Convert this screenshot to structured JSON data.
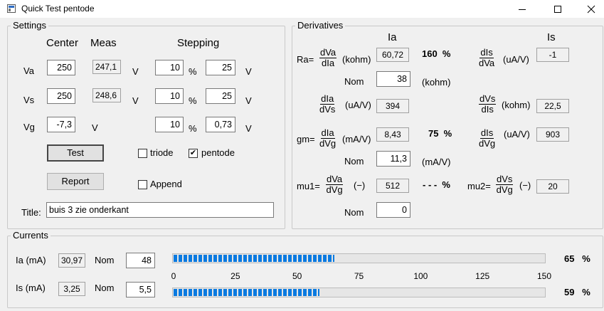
{
  "window": {
    "title": "Quick Test pentode"
  },
  "settings": {
    "group_label": "Settings",
    "col_center": "Center",
    "col_meas": "Meas",
    "col_stepping": "Stepping",
    "rows": [
      {
        "label": "Va",
        "center": "250",
        "meas": "247,1",
        "unit1": "V",
        "step_pct": "10",
        "pct_sign": "%",
        "step_val": "25",
        "unit2": "V"
      },
      {
        "label": "Vs",
        "center": "250",
        "meas": "248,6",
        "unit1": "V",
        "step_pct": "10",
        "pct_sign": "%",
        "step_val": "25",
        "unit2": "V"
      },
      {
        "label": "Vg",
        "center": "-7,3",
        "unit1": "V",
        "step_pct": "10",
        "pct_sign": "%",
        "step_val": "0,73",
        "unit2": "V"
      }
    ],
    "test_label": "Test",
    "report_label": "Report",
    "triode_label": "triode",
    "triode_checked": false,
    "pentode_label": "pentode",
    "pentode_checked": true,
    "append_label": "Append",
    "append_checked": false,
    "title_label": "Title:",
    "title_value": "buis 3 zie onderkant"
  },
  "derivatives": {
    "group_label": "Derivatives",
    "col_ia": "Ia",
    "col_is": "Is",
    "ra_label": "Ra=",
    "dva_dia": {
      "num": "dVa",
      "den": "dIa"
    },
    "kohm": "(kohm)",
    "ra_value": "60,72",
    "ra_pct": "160  %",
    "dis_dva": {
      "num": "dIs",
      "den": "dVa"
    },
    "uav": "(uA/V)",
    "dis_dva_value": "-1",
    "nom_label": "Nom",
    "ra_nom": "38",
    "ra_nom_unit": "(kohm)",
    "dia_dvs": {
      "num": "dIa",
      "den": "dVs"
    },
    "dia_dvs_value": "394",
    "dvs_dis": {
      "num": "dVs",
      "den": "dIs"
    },
    "dvs_dis_value": "22,5",
    "gm_label": "gm=",
    "dia_dvg": {
      "num": "dIa",
      "den": "dVg"
    },
    "mav": "(mA/V)",
    "gm_value": "8,43",
    "gm_pct": "75  %",
    "dis_dvg": {
      "num": "dIs",
      "den": "dVg"
    },
    "dis_dvg_value": "903",
    "gm_nom": "11,3",
    "gm_nom_unit": "(mA/V)",
    "mu1_label": "mu1=",
    "dva_dvg": {
      "num": "dVa",
      "den": "dVg"
    },
    "dimless": "(−)",
    "mu1_value": "512",
    "mu1_pct": "- - -  %",
    "mu2_label": "mu2=",
    "dvs_dvg": {
      "num": "dVs",
      "den": "dVg"
    },
    "mu2_value": "20",
    "mu_nom": "0"
  },
  "currents": {
    "group_label": "Currents",
    "ia_label": "Ia (mA)",
    "ia_value": "30,97",
    "nom_label": "Nom",
    "ia_nom": "48",
    "ia_pct": "65   %",
    "ia_level_pct": 65,
    "is_label": "Is (mA)",
    "is_value": "3,25",
    "is_nom": "5,5",
    "is_pct": "59   %",
    "is_level_pct": 59,
    "scale_ticks": [
      "0",
      "25",
      "50",
      "75",
      "100",
      "125",
      "150"
    ],
    "bar_color": "#0a7ae0"
  }
}
